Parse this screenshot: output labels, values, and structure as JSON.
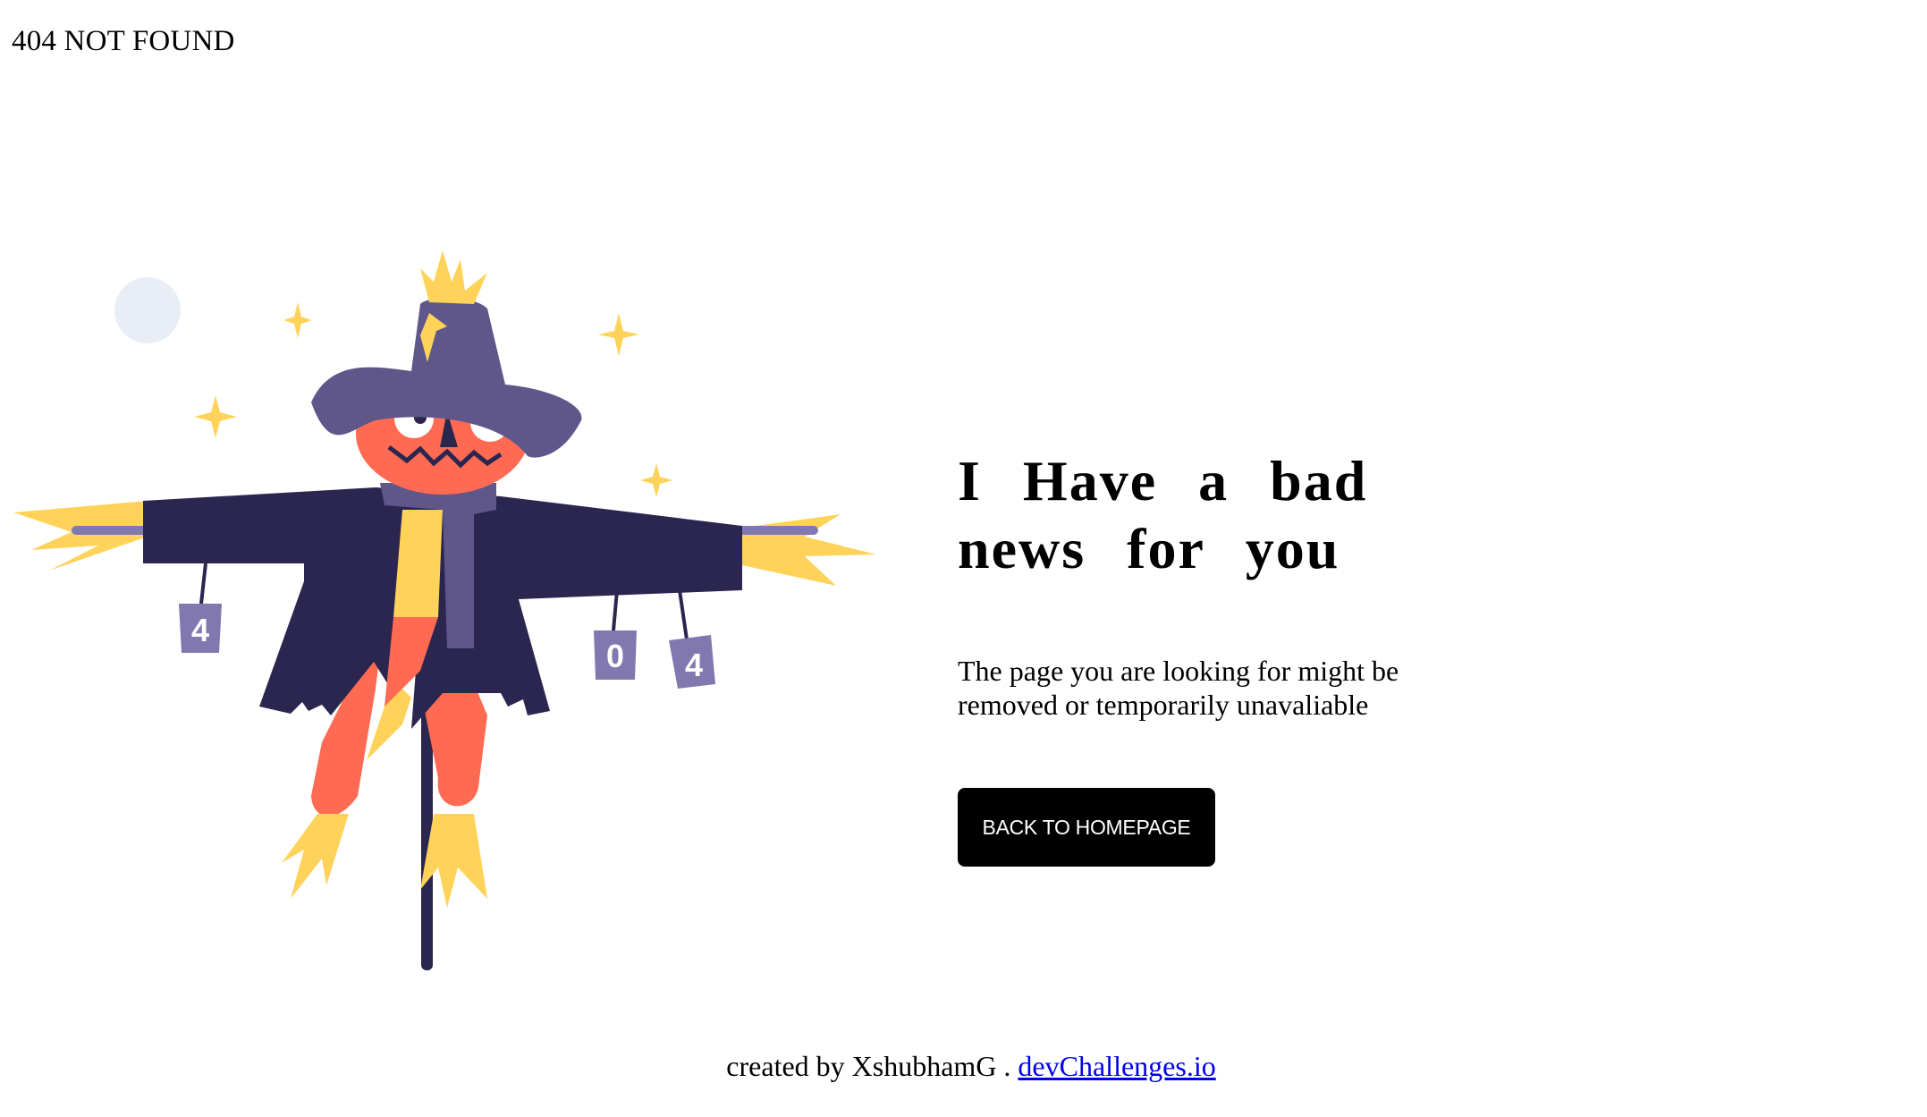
{
  "header": {
    "title": "404 NOT FOUND"
  },
  "illustration": {
    "cans": [
      "4",
      "0",
      "4"
    ],
    "colors": {
      "hat": "#5f568a",
      "coat": "#2a2650",
      "face": "#ff6b52",
      "straw": "#ffd35a",
      "can": "#8178b0",
      "moon": "#e9edf6"
    }
  },
  "main": {
    "headline": "I Have a bad news for you",
    "subtext": "The page you are looking for might be removed or temporarily unavaliable",
    "button_label": "BACK TO HOMEPAGE"
  },
  "footer": {
    "prefix": "created by XshubhamG . ",
    "link_text": "devChallenges.io"
  }
}
